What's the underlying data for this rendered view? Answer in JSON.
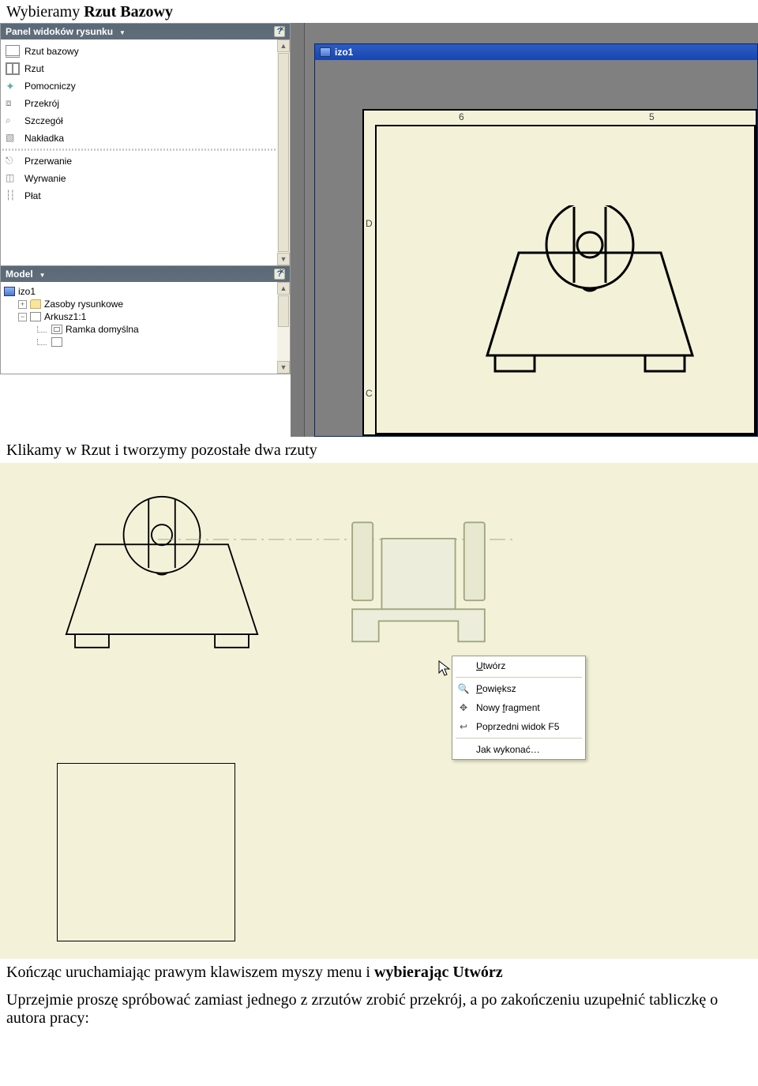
{
  "text": {
    "line1_a": "Wybieramy ",
    "line1_b": "Rzut Bazowy",
    "line2": "Klikamy w Rzut i tworzymy pozostałe dwa rzuty",
    "line3_a": "Kończąc uruchamiając prawym klawiszem myszy menu i ",
    "line3_b": "wybierając Utwórz",
    "para2": "Uprzejmie proszę spróbować zamiast jednego z zrzutów zrobić przekrój, a po zakończeniu uzupełnić tabliczkę o autora pracy:"
  },
  "panel_views": {
    "title": "Panel widoków rysunku",
    "items": [
      {
        "icon": "i-rb",
        "label": "Rzut bazowy"
      },
      {
        "icon": "i-rz",
        "label": "Rzut"
      },
      {
        "icon": "i-pom",
        "label": "Pomocniczy"
      },
      {
        "icon": "i-prz",
        "label": "Przekrój"
      },
      {
        "icon": "i-szc",
        "label": "Szczegół"
      },
      {
        "icon": "i-nak",
        "label": "Nakładka"
      }
    ],
    "items2": [
      {
        "icon": "i-brk",
        "label": "Przerwanie"
      },
      {
        "icon": "i-wyr",
        "label": "Wyrwanie"
      },
      {
        "icon": "i-plat",
        "label": "Płat"
      }
    ]
  },
  "panel_model": {
    "title": "Model",
    "root": "izo1",
    "res": "Zasoby rysunkowe",
    "sheet": "Arkusz1:1",
    "frame": "Ramka domyślna"
  },
  "doc_window": {
    "title": "izo1"
  },
  "paper": {
    "col6": "6",
    "col5": "5",
    "rowD": "D",
    "rowC": "C"
  },
  "context_menu": {
    "items": [
      {
        "icon": "",
        "label": "Utwórz",
        "u": "U"
      },
      {
        "icon": "🔍",
        "label": "Powiększ",
        "u": "P"
      },
      {
        "icon": "✥",
        "label": "Nowy fragment",
        "u": "f"
      },
      {
        "icon": "↩",
        "label": "Poprzedni widok F5",
        "u": ""
      }
    ],
    "how": "Jak wykonać…"
  }
}
